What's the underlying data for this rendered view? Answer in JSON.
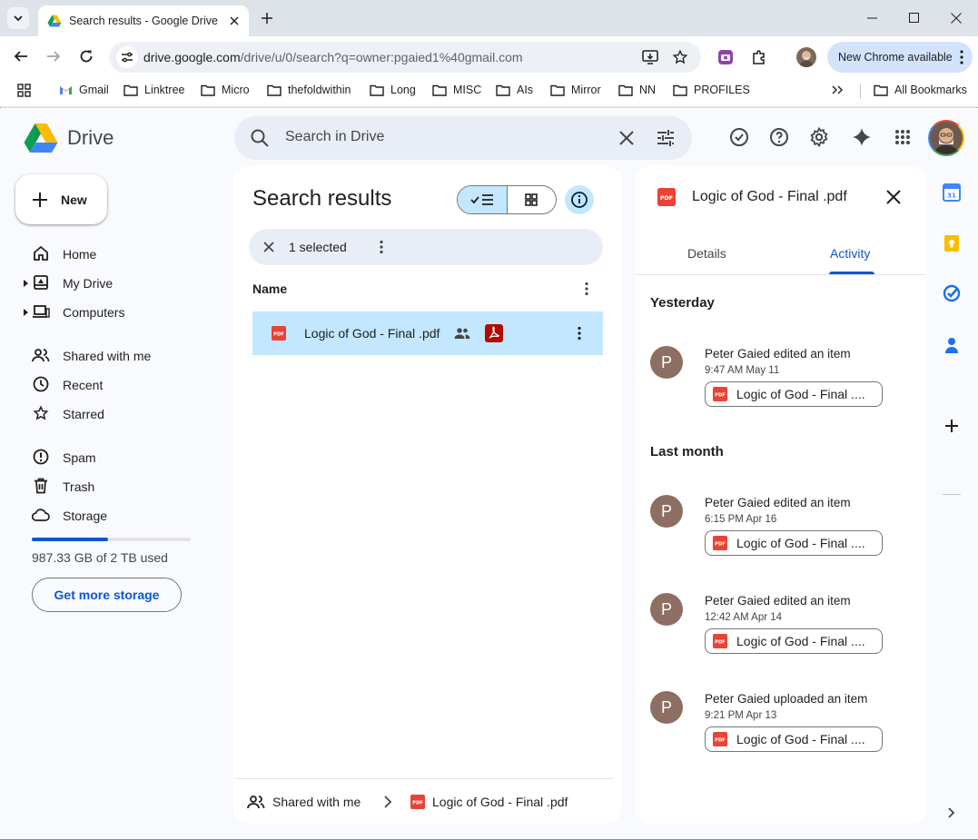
{
  "browser": {
    "tab_title": "Search results - Google Drive",
    "url_host": "drive.google.com",
    "url_path": "/drive/u/0/search?q=owner:pgaied1%40gmail.com",
    "update_label": "New Chrome available",
    "bookmarks": [
      "Gmail",
      "Linktree",
      "Micro",
      "thefoldwithin",
      "Long",
      "MISC",
      "AIs",
      "Mirror",
      "NN",
      "PROFILES"
    ],
    "all_bookmarks": "All Bookmarks"
  },
  "drive": {
    "app_name": "Drive",
    "search_placeholder": "Search in Drive",
    "new_label": "New",
    "nav": [
      "Home",
      "My Drive",
      "Computers",
      "Shared with me",
      "Recent",
      "Starred",
      "Spam",
      "Trash",
      "Storage"
    ],
    "storage_used_fraction": 0.48,
    "storage_text": "987.33 GB of 2 TB used",
    "get_storage": "Get more storage"
  },
  "results": {
    "heading": "Search results",
    "selected": "1 selected",
    "column": "Name",
    "file_name": "Logic of God - Final .pdf",
    "pdf_badge": "PDF",
    "path_root": "Shared with me",
    "path_file": "Logic of God - Final .pdf"
  },
  "details": {
    "title": "Logic of God - Final .pdf",
    "tab_details": "Details",
    "tab_activity": "Activity",
    "section_yesterday": "Yesterday",
    "section_last_month": "Last month",
    "activities": [
      {
        "initial": "P",
        "who": "Peter Gaied edited an item",
        "when": "9:47 AM May 11",
        "file": "Logic of God - Final ...."
      },
      {
        "initial": "P",
        "who": "Peter Gaied edited an item",
        "when": "6:15 PM Apr 16",
        "file": "Logic of God - Final ...."
      },
      {
        "initial": "P",
        "who": "Peter Gaied edited an item",
        "when": "12:42 AM Apr 14",
        "file": "Logic of God - Final ...."
      },
      {
        "initial": "P",
        "who": "Peter Gaied uploaded an item",
        "when": "9:21 PM Apr 13",
        "file": "Logic of God - Final ...."
      }
    ]
  },
  "colors": {
    "accent": "#0b57d0",
    "selected_row": "#c2e7ff",
    "pdf_red": "#ea4335",
    "avatar_brown": "#8d6e63"
  }
}
